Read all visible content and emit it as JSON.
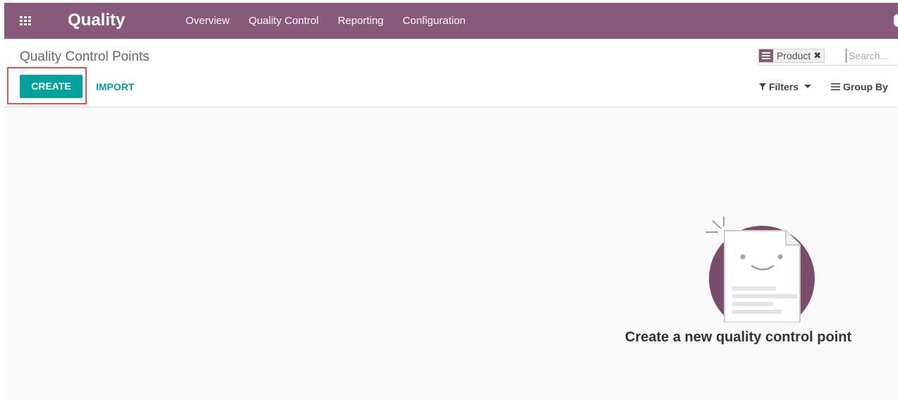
{
  "navbar": {
    "app_name": "Quality",
    "menu": [
      {
        "label": "Overview"
      },
      {
        "label": "Quality Control"
      },
      {
        "label": "Reporting"
      },
      {
        "label": "Configuration"
      }
    ],
    "background_color": "#875a7b"
  },
  "control_panel": {
    "title": "Quality Control Points",
    "create_label": "CREATE",
    "import_label": "IMPORT",
    "search": {
      "facet_value": "Product",
      "placeholder": "Search..."
    },
    "filters_label": "Filters",
    "groupby_label": "Group By",
    "accent_color": "#00a09d",
    "highlight_color": "#e0524f"
  },
  "empty_state": {
    "title": "Create a new quality control point"
  }
}
